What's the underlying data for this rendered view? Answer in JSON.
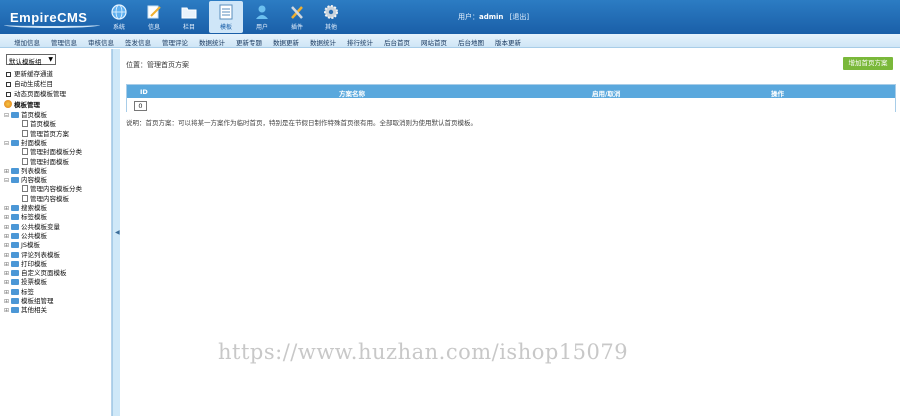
{
  "header": {
    "logo_text": "EmpireCMS",
    "nav": [
      {
        "label": "系统",
        "icon": "globe-icon"
      },
      {
        "label": "信息",
        "icon": "pencil-icon"
      },
      {
        "label": "栏目",
        "icon": "folder-icon"
      },
      {
        "label": "模板",
        "icon": "template-icon",
        "active": true
      },
      {
        "label": "用户",
        "icon": "user-icon"
      },
      {
        "label": "插件",
        "icon": "tools-icon"
      },
      {
        "label": "其他",
        "icon": "gear-icon"
      }
    ],
    "user_prefix": "用户：",
    "username": "admin",
    "logout": "[退出]"
  },
  "menubar": [
    "增加信息",
    "管理信息",
    "审核信息",
    "签发信息",
    "管理评论",
    "数据统计",
    "更新专题",
    "数据更新",
    "数据统计",
    "排行统计",
    "后台首页",
    "网站首页",
    "后台地图",
    "版本更新"
  ],
  "sidebar": {
    "select_value": "默认模板组",
    "quick": [
      "更新缓存通道",
      "自动生成栏目",
      "动态页面模板管理"
    ],
    "root_label": "模板管理",
    "tree": [
      {
        "label": "首页模板",
        "level": 0,
        "type": "folder",
        "open": true
      },
      {
        "label": "首页模板",
        "level": 1,
        "type": "doc"
      },
      {
        "label": "管理首页方案",
        "level": 1,
        "type": "doc"
      },
      {
        "label": "封面模板",
        "level": 0,
        "type": "folder",
        "open": true
      },
      {
        "label": "管理封面模板分类",
        "level": 1,
        "type": "doc"
      },
      {
        "label": "管理封面模板",
        "level": 1,
        "type": "doc"
      },
      {
        "label": "列表模板",
        "level": 0,
        "type": "folder"
      },
      {
        "label": "内容模板",
        "level": 0,
        "type": "folder",
        "open": true
      },
      {
        "label": "管理内容模板分类",
        "level": 1,
        "type": "doc"
      },
      {
        "label": "管理内容模板",
        "level": 1,
        "type": "doc"
      },
      {
        "label": "搜索模板",
        "level": 0,
        "type": "folder"
      },
      {
        "label": "标签模板",
        "level": 0,
        "type": "folder"
      },
      {
        "label": "公共模板变量",
        "level": 0,
        "type": "folder"
      },
      {
        "label": "公共模板",
        "level": 0,
        "type": "folder"
      },
      {
        "label": "JS模板",
        "level": 0,
        "type": "folder"
      },
      {
        "label": "评论列表模板",
        "level": 0,
        "type": "folder"
      },
      {
        "label": "打印模板",
        "level": 0,
        "type": "folder"
      },
      {
        "label": "自定义页面模板",
        "level": 0,
        "type": "folder"
      },
      {
        "label": "投票模板",
        "level": 0,
        "type": "folder"
      },
      {
        "label": "标签",
        "level": 0,
        "type": "folder"
      },
      {
        "label": "模板组管理",
        "level": 0,
        "type": "folder"
      },
      {
        "label": "其他相关",
        "level": 0,
        "type": "folder"
      }
    ]
  },
  "main": {
    "breadcrumb": "位置：管理首页方案",
    "add_button": "增加首页方案",
    "table": {
      "headers": [
        "ID",
        "方案名称",
        "启用/取消",
        "操作"
      ],
      "row_value": "0"
    },
    "note": "说明：首页方案：可以将某一方案作为临时首页，特别是在节假日制作特殊首页很有用。全部取消则为使用默认首页模板。"
  },
  "watermark": "https://www.huzhan.com/ishop15079"
}
